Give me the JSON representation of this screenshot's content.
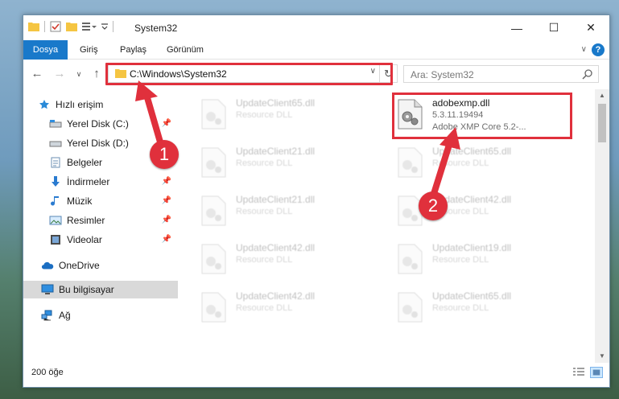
{
  "window": {
    "title": "System32",
    "minimize": "—",
    "maximize": "☐",
    "close": "✕"
  },
  "ribbon": {
    "tabs": [
      "Dosya",
      "Giriş",
      "Paylaş",
      "Görünüm"
    ],
    "help": "?"
  },
  "navbar": {
    "address": "C:\\Windows\\System32",
    "search_placeholder": "Ara: System32"
  },
  "sidebar": {
    "items": [
      {
        "label": "Hızlı erişim",
        "icon": "star-icon"
      },
      {
        "label": "Yerel Disk (C:)",
        "icon": "drive-icon",
        "pinned": true
      },
      {
        "label": "Yerel Disk (D:)",
        "icon": "drive-icon",
        "pinned": false
      },
      {
        "label": "Belgeler",
        "icon": "documents-icon",
        "pinned": true
      },
      {
        "label": "İndirmeler",
        "icon": "downloads-icon",
        "pinned": true
      },
      {
        "label": "Müzik",
        "icon": "music-icon",
        "pinned": true
      },
      {
        "label": "Resimler",
        "icon": "pictures-icon",
        "pinned": true
      },
      {
        "label": "Videolar",
        "icon": "videos-icon",
        "pinned": true
      },
      {
        "label": "OneDrive",
        "icon": "onedrive-icon"
      },
      {
        "label": "Bu bilgisayar",
        "icon": "computer-icon",
        "selected": true
      },
      {
        "label": "Ağ",
        "icon": "network-icon"
      }
    ]
  },
  "files": {
    "highlighted": {
      "name": "adobexmp.dll",
      "version": "5.3.11.19494",
      "description": "Adobe XMP Core 5.2-..."
    },
    "left_column": [
      {
        "name": "UpdateClient65.dll",
        "type": "Resource DLL"
      },
      {
        "name": "UpdateClient21.dll",
        "type": "Resource DLL"
      },
      {
        "name": "UpdateClient21.dll",
        "type": "Resource DLL"
      },
      {
        "name": "UpdateClient42.dll",
        "type": "Resource DLL"
      },
      {
        "name": "UpdateClient42.dll",
        "type": "Resource DLL"
      }
    ],
    "right_column": [
      {
        "name": "UpdateClient65.dll",
        "type": "Resource DLL"
      },
      {
        "name": "UpdateClient42.dll",
        "type": "Resource DLL"
      },
      {
        "name": "UpdateClient19.dll",
        "type": "Resource DLL"
      },
      {
        "name": "UpdateClient65.dll",
        "type": "Resource DLL"
      }
    ]
  },
  "status": {
    "count": "200 öğe"
  },
  "annotations": {
    "step1": "1",
    "step2": "2"
  },
  "colors": {
    "accent": "#1979ca",
    "highlight_red": "#e0303c",
    "selection": "#d9d9d9"
  }
}
